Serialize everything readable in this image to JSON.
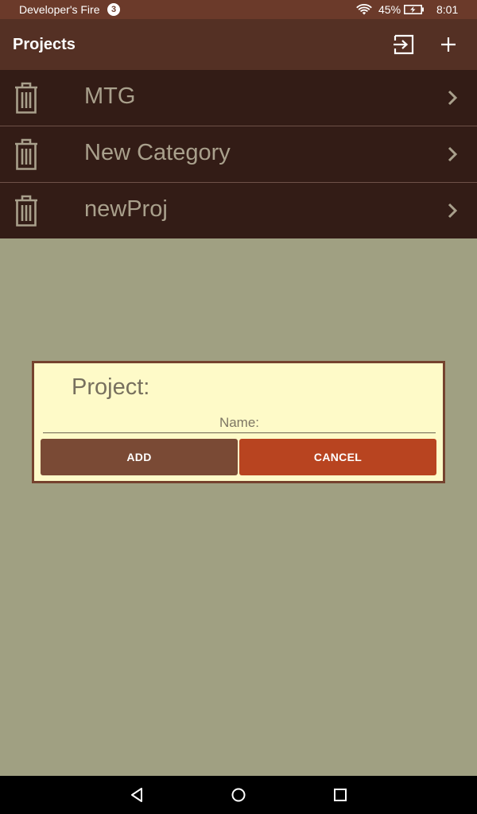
{
  "status_bar": {
    "carrier": "Developer's Fire",
    "notification_count": "3",
    "battery_percent": "45%",
    "time": "8:01",
    "icons": [
      "wifi-icon",
      "battery-charging-icon"
    ]
  },
  "app_bar": {
    "title": "Projects",
    "actions": [
      "export-icon",
      "plus-icon"
    ]
  },
  "projects": {
    "items": [
      {
        "label": "MTG"
      },
      {
        "label": "New Category"
      },
      {
        "label": "newProj"
      }
    ]
  },
  "dialog": {
    "title": "Project:",
    "name_placeholder": "Name:",
    "name_value": "",
    "add_label": "ADD",
    "cancel_label": "CANCEL"
  },
  "nav_bar": {
    "icons": [
      "back-icon",
      "home-icon",
      "recents-icon"
    ]
  },
  "colors": {
    "status_bar": "#6b3a2a",
    "app_bar": "#543024",
    "list_bg": "#331c16",
    "page_bg": "#a0a082",
    "dialog_bg": "#fefac8",
    "dialog_border": "#75422e",
    "add_button": "#7a4a35",
    "cancel_button": "#b84420"
  }
}
